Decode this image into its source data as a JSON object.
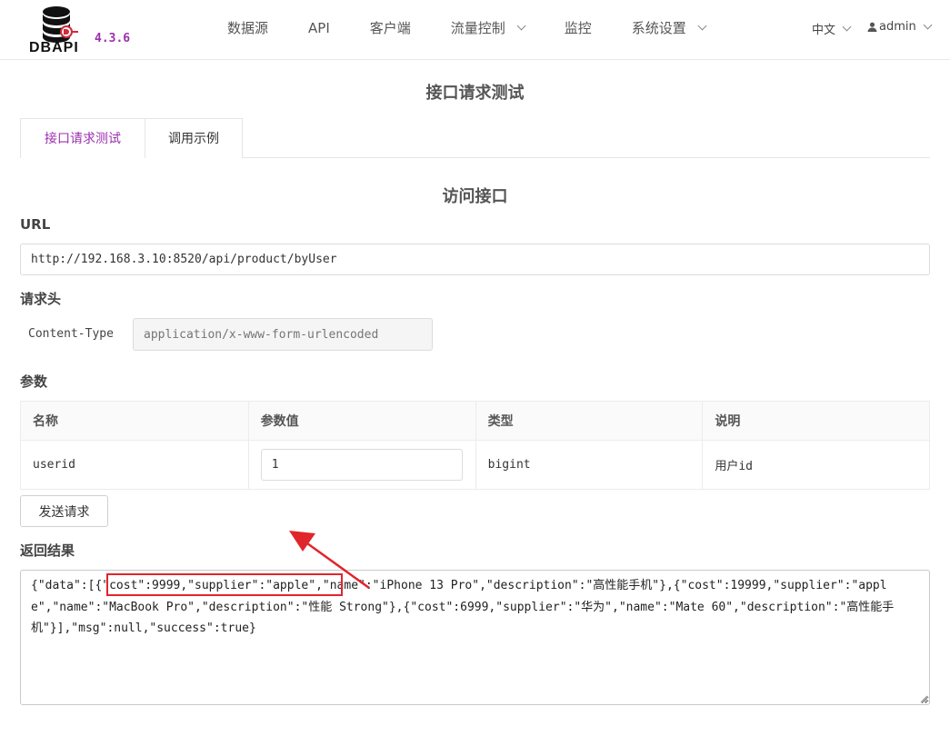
{
  "app": {
    "logo_text": "DBAPI",
    "version": "4.3.6"
  },
  "nav": {
    "items": [
      {
        "label": "数据源",
        "dropdown": false
      },
      {
        "label": "API",
        "dropdown": false
      },
      {
        "label": "客户端",
        "dropdown": false
      },
      {
        "label": "流量控制",
        "dropdown": true
      },
      {
        "label": "监控",
        "dropdown": false
      },
      {
        "label": "系统设置",
        "dropdown": true
      }
    ],
    "language": "中文",
    "user": "admin"
  },
  "page": {
    "title": "接口请求测试",
    "tabs": [
      {
        "label": "接口请求测试",
        "active": true
      },
      {
        "label": "调用示例",
        "active": false
      }
    ],
    "section_title": "访问接口"
  },
  "form": {
    "url_label": "URL",
    "url_value": "http://192.168.3.10:8520/api/product/byUser",
    "headers_label": "请求头",
    "header_name": "Content-Type",
    "header_value": "application/x-www-form-urlencoded",
    "params_label": "参数",
    "columns": [
      "名称",
      "参数值",
      "类型",
      "说明"
    ],
    "params": [
      {
        "name": "userid",
        "value": "1",
        "type": "bigint",
        "desc": "用户id"
      }
    ],
    "send_label": "发送请求",
    "result_label": "返回结果",
    "result_text": "{\"data\":[{\"cost\":9999,\"supplier\":\"apple\",\"name\":\"iPhone 13 Pro\",\"description\":\"高性能手机\"},{\"cost\":19999,\"supplier\":\"apple\",\"name\":\"MacBook Pro\",\"description\":\"性能 Strong\"},{\"cost\":6999,\"supplier\":\"华为\",\"name\":\"Mate 60\",\"description\":\"高性能手机\"}],\"msg\":null,\"success\":true}"
  },
  "colors": {
    "accent": "#9b2fae",
    "annotation": "#e0262b"
  }
}
